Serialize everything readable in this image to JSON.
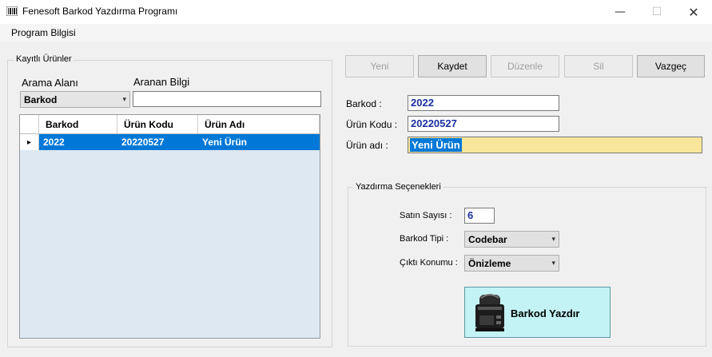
{
  "window": {
    "title": "Fenesoft Barkod Yazdırma Programı",
    "controls": {
      "minimize": "—",
      "maximize": "☐",
      "close": "✕"
    }
  },
  "menu": {
    "items": [
      "Program Bilgisi"
    ]
  },
  "left_panel": {
    "group_title": "Kayıtlı Ürünler",
    "search_field_label": "Arama Alanı",
    "search_value_label": "Aranan Bilgi",
    "search_field_selected": "Barkod",
    "search_value": "",
    "grid": {
      "columns": [
        "Barkod",
        "Ürün Kodu",
        "Ürün Adı"
      ],
      "rows": [
        {
          "barkod": "2022",
          "urun_kodu": "20220527",
          "urun_adi": "Yeni Ürün",
          "selected": true
        }
      ],
      "row_indicator": "▸"
    }
  },
  "toolbar": {
    "yeni": "Yeni",
    "kaydet": "Kaydet",
    "duzenle": "Düzenle",
    "sil": "Sil",
    "vazgec": "Vazgeç"
  },
  "form": {
    "barkod_label": "Barkod :",
    "barkod_value": "2022",
    "urun_kodu_label": "Ürün Kodu :",
    "urun_kodu_value": "20220527",
    "urun_adi_label": "Ürün adı :",
    "urun_adi_value": "Yeni Ürün"
  },
  "print_options": {
    "group_title": "Yazdırma Seçenekleri",
    "copies_label": "Satın Sayısı :",
    "copies_value": "6",
    "type_label": "Barkod Tipi :",
    "type_value": "Codebar",
    "output_label": "Çıktı Konumu :",
    "output_value": "Önizleme",
    "print_button": "Barkod Yazdır"
  },
  "colors": {
    "selection": "#0078d7",
    "grid_bg": "#dde8f3",
    "highlight_field": "#f8e79a",
    "print_button_bg": "#c4f3f6",
    "value_text": "#1a2fa0"
  },
  "icons": [
    "barcode-app-icon",
    "printer-icon",
    "chevron-down-icon",
    "row-pointer-icon"
  ]
}
